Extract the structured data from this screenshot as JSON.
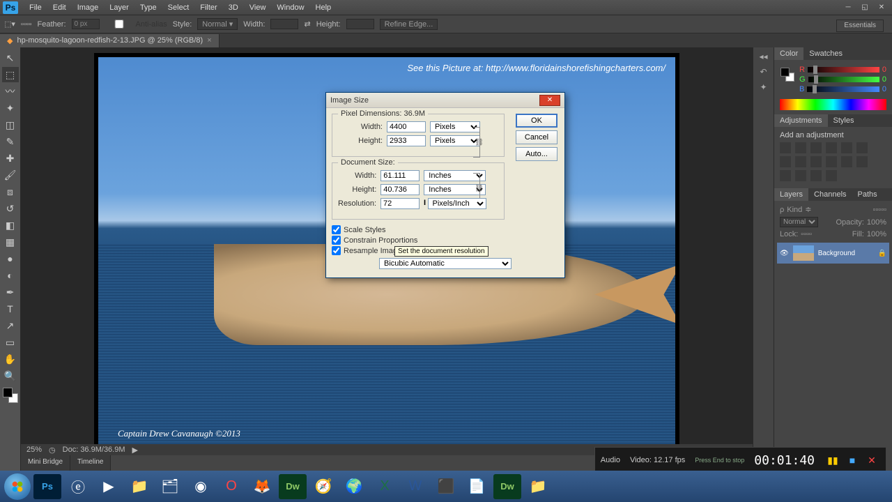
{
  "menubar": [
    "File",
    "Edit",
    "Image",
    "Layer",
    "Type",
    "Select",
    "Filter",
    "3D",
    "View",
    "Window",
    "Help"
  ],
  "optionsbar": {
    "feather_label": "Feather:",
    "feather_val": "0 px",
    "antialias": "Anti-alias",
    "style_label": "Style:",
    "style_val": "Normal",
    "width_label": "Width:",
    "height_label": "Height:",
    "refine": "Refine Edge..."
  },
  "document_tab": "hp-mosquito-lagoon-redfish-2-13.JPG @ 25% (RGB/8)",
  "essentials": "Essentials",
  "canvas": {
    "watermark": "See this Picture at:  http://www.floridainshorefishingcharters.com/",
    "signature": "Captain Drew Cavanaugh ©2013"
  },
  "status": {
    "zoom": "25%",
    "doc": "Doc: 36.9M/36.9M"
  },
  "bottom_tabs": [
    "Mini Bridge",
    "Timeline"
  ],
  "panels": {
    "color_tab": "Color",
    "swatches_tab": "Swatches",
    "rgb": {
      "r": "R",
      "g": "G",
      "b": "B",
      "val": "0"
    },
    "adjustments_tab": "Adjustments",
    "styles_tab": "Styles",
    "add_adj": "Add an adjustment",
    "layers_tab": "Layers",
    "channels_tab": "Channels",
    "paths_tab": "Paths",
    "kind": "Kind",
    "blend": "Normal",
    "opacity_label": "Opacity:",
    "opacity_val": "100%",
    "lock_label": "Lock:",
    "fill_label": "Fill:",
    "fill_val": "100%",
    "layer_name": "Background"
  },
  "dialog": {
    "title": "Image Size",
    "pixel_dim_label": "Pixel Dimensions:",
    "pixel_dim_val": "36.9M",
    "width_label": "Width:",
    "height_label": "Height:",
    "px_width": "4400",
    "px_height": "2933",
    "px_unit": "Pixels",
    "doc_size_label": "Document Size:",
    "doc_width": "61.111",
    "doc_height": "40.736",
    "doc_unit": "Inches",
    "res_label": "Resolution:",
    "res_val": "72",
    "res_unit": "Pixels/Inch",
    "tooltip": "Set the document resolution",
    "scale_styles": "Scale Styles",
    "constrain": "Constrain Proportions",
    "resample": "Resample Image:",
    "resample_method": "Bicubic Automatic",
    "ok": "OK",
    "cancel": "Cancel",
    "auto": "Auto..."
  },
  "recorder": {
    "audio_label": "Audio",
    "video_label": "Video: 12.17 fps",
    "hint": "Press End to stop",
    "time": "00:01:40"
  }
}
